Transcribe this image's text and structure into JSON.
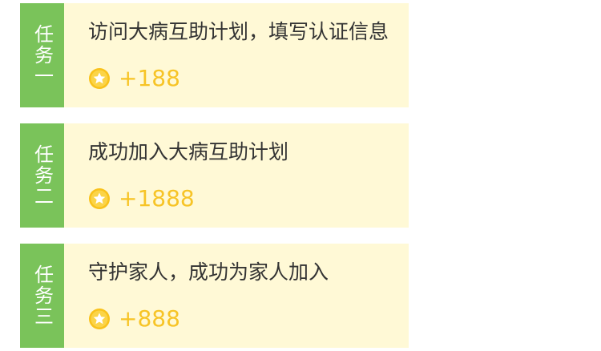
{
  "colors": {
    "tag_background": "#7ac35a",
    "card_background": "#fff9d6",
    "reward_color": "#f7c426",
    "title_color": "#333333"
  },
  "tasks": [
    {
      "tag": "任务一",
      "title": "访问大病互助计划，填写认证信息",
      "reward": "+188",
      "reward_icon": "coin-star-icon"
    },
    {
      "tag": "任务二",
      "title": "成功加入大病互助计划",
      "reward": "+1888",
      "reward_icon": "coin-star-icon"
    },
    {
      "tag": "任务三",
      "title": "守护家人，成功为家人加入",
      "reward": "+888",
      "reward_icon": "coin-star-icon"
    }
  ]
}
